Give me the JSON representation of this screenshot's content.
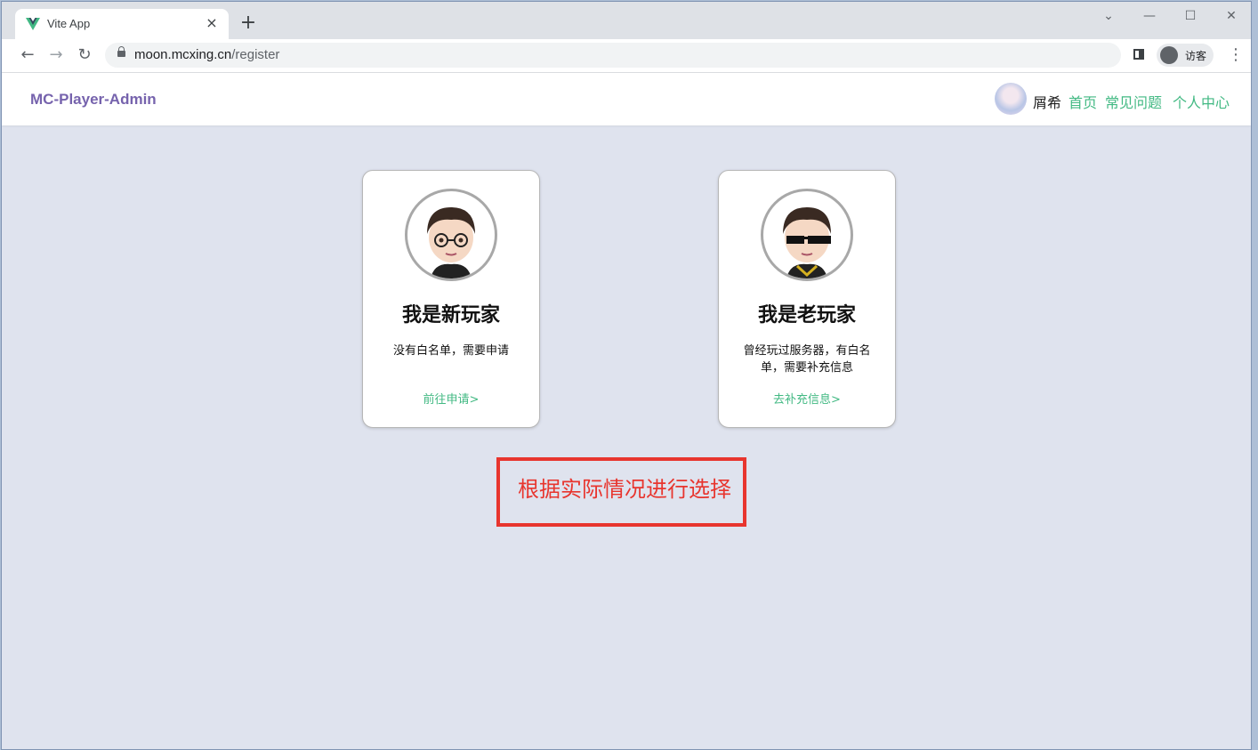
{
  "browser": {
    "tab_title": "Vite App",
    "tab_close_icon": "×",
    "new_tab_icon": "+",
    "url_host": "moon.mcxing.cn",
    "url_path": "/register",
    "profile_label": "访客",
    "controls": {
      "tab_search": "⌄",
      "minimize": "—",
      "maximize": "☐",
      "close": "✕",
      "back": "←",
      "forward": "→",
      "reload": "↻",
      "menu": "⋮"
    }
  },
  "header": {
    "brand": "MC-Player-Admin",
    "user_name": "屑希",
    "nav": [
      "首页",
      "常见问题",
      "个人中心"
    ]
  },
  "cards": [
    {
      "title": "我是新玩家",
      "description": "没有白名单，需要申请",
      "link": "前往申请>"
    },
    {
      "title": "我是老玩家",
      "description": "曾经玩过服务器，有白名单，需要补充信息",
      "link": "去补充信息>"
    }
  ],
  "annotation": "根据实际情况进行选择",
  "colors": {
    "brand": "#7663ad",
    "accent": "#42b983",
    "annotation": "#e8352e",
    "page_bg": "#dfe3ee"
  },
  "icons": [
    "vue-logo-icon",
    "close-icon",
    "plus-icon",
    "back-arrow-icon",
    "forward-arrow-icon",
    "reload-icon",
    "lock-icon",
    "side-panel-icon",
    "profile-icon",
    "more-menu-icon",
    "avatar-glasses-icon",
    "avatar-sunglasses-icon"
  ]
}
